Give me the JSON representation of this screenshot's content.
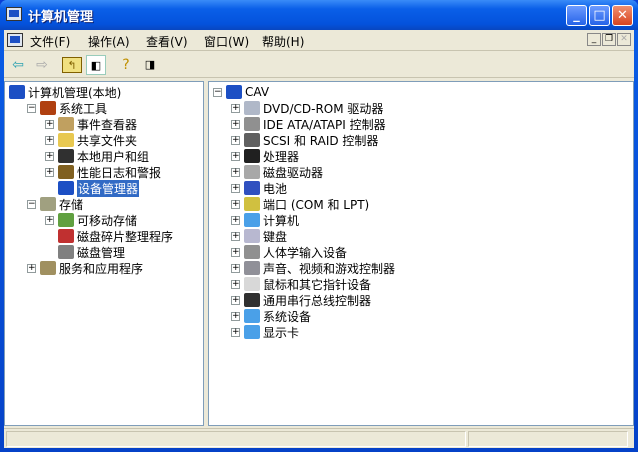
{
  "window": {
    "title": "计算机管理"
  },
  "menu": [
    "文件(F)",
    "操作(A)",
    "查看(V)",
    "窗口(W)",
    "帮助(H)"
  ],
  "mdi_controls": [
    "_",
    "❐",
    "✕"
  ],
  "toolbar": [
    "back",
    "forward",
    "up-folder",
    "show-hide-tree",
    "help",
    "show-hide-action-pane"
  ],
  "left_tree": [
    {
      "label": "计算机管理(本地)",
      "level": 0,
      "exp": "",
      "icon": "computer-icon",
      "color": "#1c4fc4"
    },
    {
      "label": "系统工具",
      "level": 1,
      "exp": "−",
      "icon": "tools-icon",
      "color": "#b04010"
    },
    {
      "label": "事件查看器",
      "level": 2,
      "exp": "+",
      "icon": "event-viewer-icon",
      "color": "#c0a060"
    },
    {
      "label": "共享文件夹",
      "level": 2,
      "exp": "+",
      "icon": "shared-folder-icon",
      "color": "#e8c850"
    },
    {
      "label": "本地用户和组",
      "level": 2,
      "exp": "+",
      "icon": "users-icon",
      "color": "#303030"
    },
    {
      "label": "性能日志和警报",
      "level": 2,
      "exp": "+",
      "icon": "performance-icon",
      "color": "#806020"
    },
    {
      "label": "设备管理器",
      "level": 2,
      "exp": "",
      "icon": "device-manager-icon",
      "color": "#1c4fc4",
      "selected": true
    },
    {
      "label": "存储",
      "level": 1,
      "exp": "−",
      "icon": "storage-icon",
      "color": "#a0a080"
    },
    {
      "label": "可移动存储",
      "level": 2,
      "exp": "+",
      "icon": "removable-storage-icon",
      "color": "#60a040"
    },
    {
      "label": "磁盘碎片整理程序",
      "level": 2,
      "exp": "",
      "icon": "defrag-icon",
      "color": "#c03030"
    },
    {
      "label": "磁盘管理",
      "level": 2,
      "exp": "",
      "icon": "disk-management-icon",
      "color": "#808080"
    },
    {
      "label": "服务和应用程序",
      "level": 1,
      "exp": "+",
      "icon": "services-icon",
      "color": "#a09060"
    }
  ],
  "right_tree": {
    "root": "CAV",
    "items": [
      {
        "label": "DVD/CD-ROM 驱动器",
        "icon": "cdrom-icon",
        "color": "#b0b8c8"
      },
      {
        "label": "IDE ATA/ATAPI 控制器",
        "icon": "ide-controller-icon",
        "color": "#909090"
      },
      {
        "label": "SCSI 和 RAID 控制器",
        "icon": "scsi-icon",
        "color": "#606060"
      },
      {
        "label": "处理器",
        "icon": "processor-icon",
        "color": "#202020"
      },
      {
        "label": "磁盘驱动器",
        "icon": "disk-drive-icon",
        "color": "#a8a8a8"
      },
      {
        "label": "电池",
        "icon": "battery-icon",
        "color": "#3050c0"
      },
      {
        "label": "端口 (COM 和 LPT)",
        "icon": "port-icon",
        "color": "#d0c040"
      },
      {
        "label": "计算机",
        "icon": "computer-icon",
        "color": "#4aa0e8"
      },
      {
        "label": "键盘",
        "icon": "keyboard-icon",
        "color": "#b8b8d0"
      },
      {
        "label": "人体学输入设备",
        "icon": "hid-icon",
        "color": "#909090"
      },
      {
        "label": "声音、视频和游戏控制器",
        "icon": "sound-icon",
        "color": "#909098"
      },
      {
        "label": "鼠标和其它指针设备",
        "icon": "mouse-icon",
        "color": "#d8d8d8"
      },
      {
        "label": "通用串行总线控制器",
        "icon": "usb-icon",
        "color": "#303030"
      },
      {
        "label": "系统设备",
        "icon": "system-device-icon",
        "color": "#4aa0e8"
      },
      {
        "label": "显示卡",
        "icon": "display-adapter-icon",
        "color": "#4aa0e8"
      }
    ]
  }
}
